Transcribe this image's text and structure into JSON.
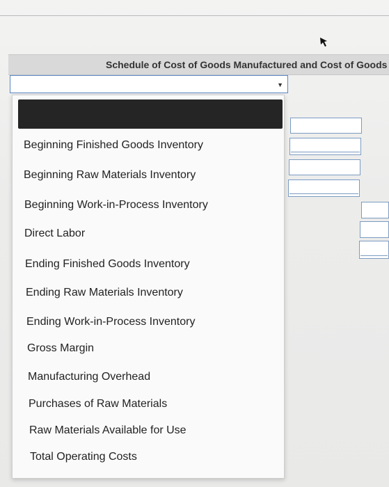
{
  "header": {
    "title": "Schedule of Cost of Goods Manufactured and Cost of Goods"
  },
  "select": {
    "value": "",
    "arrow_icon": "triangle-down-icon"
  },
  "dropdown": {
    "selected_label": "",
    "items": [
      "Beginning Finished Goods Inventory",
      "Beginning Raw Materials Inventory",
      "Beginning Work-in-Process Inventory",
      "Direct Labor",
      "Ending Finished Goods Inventory",
      "Ending Raw Materials Inventory",
      "Ending Work-in-Process Inventory",
      "Gross Margin",
      "Manufacturing Overhead",
      "Purchases of Raw Materials",
      "Raw Materials Available for Use",
      "Total Operating Costs"
    ]
  },
  "input_cells": {
    "column_a": [
      "",
      "",
      "",
      ""
    ],
    "column_b": [
      "",
      "",
      ""
    ]
  },
  "colors": {
    "header_bg": "#d9d9d9",
    "select_border": "#5a86c4",
    "selected_item_bg": "#252525",
    "cell_border": "#7a9bc2"
  }
}
